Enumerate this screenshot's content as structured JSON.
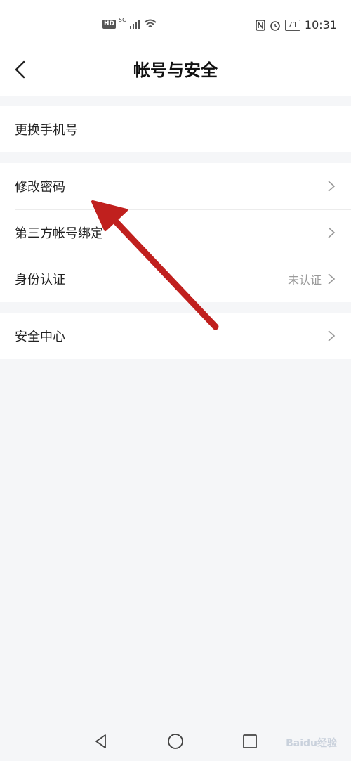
{
  "status_bar": {
    "hd": "HD",
    "network": "5G",
    "battery": "71",
    "time": "10:31"
  },
  "header": {
    "title": "帐号与安全"
  },
  "groups": [
    {
      "items": [
        {
          "label": "更换手机号"
        }
      ]
    },
    {
      "items": [
        {
          "label": "修改密码"
        },
        {
          "label": "第三方帐号绑定"
        },
        {
          "label": "身份认证",
          "status": "未认证"
        }
      ]
    },
    {
      "items": [
        {
          "label": "安全中心"
        }
      ]
    }
  ],
  "annotation": {
    "arrow_color": "#c0201e"
  },
  "watermark": "Baidu经验",
  "icons": [
    "back-icon",
    "chevron-right-icon",
    "nav-back-icon",
    "nav-home-icon",
    "nav-recent-icon",
    "wifi-icon",
    "signal-icon",
    "nfc-icon",
    "alarm-icon",
    "battery-icon"
  ]
}
